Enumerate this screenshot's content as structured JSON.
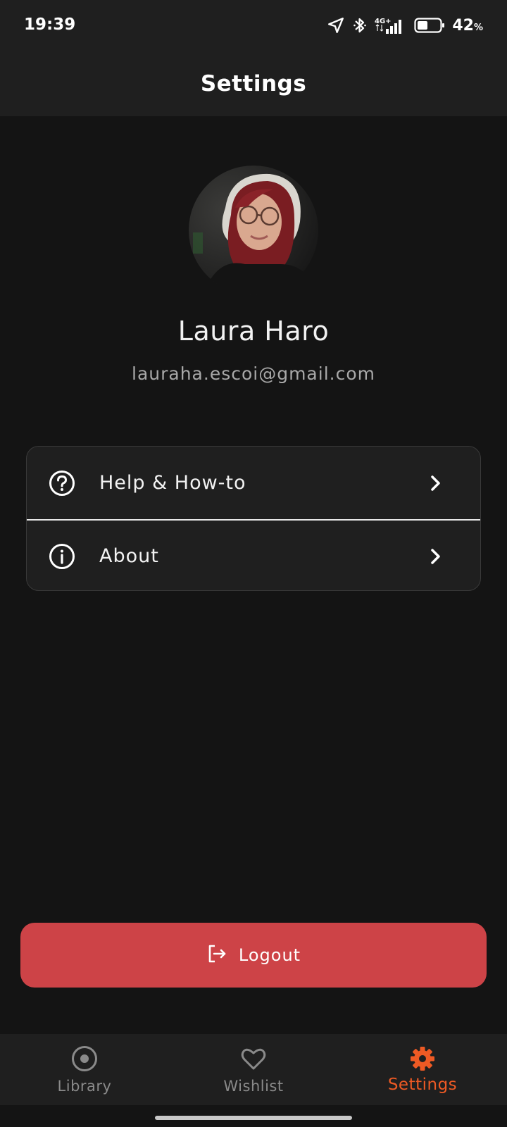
{
  "status_bar": {
    "time": "19:39",
    "network": "4G+",
    "battery_percent": "42",
    "battery_unit": "%",
    "icons": [
      "location-arrow-icon",
      "bluetooth-icon",
      "signal-icon",
      "battery-icon"
    ]
  },
  "app_bar": {
    "title": "Settings"
  },
  "profile": {
    "name": "Laura Haro",
    "email": "lauraha.escoi@gmail.com"
  },
  "menu": {
    "items": [
      {
        "label": "Help & How-to",
        "icon": "help-circle-icon"
      },
      {
        "label": "About",
        "icon": "info-circle-icon"
      }
    ]
  },
  "logout": {
    "label": "Logout",
    "icon": "logout-icon"
  },
  "bottom_nav": {
    "items": [
      {
        "label": "Library",
        "icon": "disc-icon",
        "active": false
      },
      {
        "label": "Wishlist",
        "icon": "heart-icon",
        "active": false
      },
      {
        "label": "Settings",
        "icon": "gear-icon",
        "active": true
      }
    ]
  },
  "colors": {
    "background": "#141414",
    "surface": "#1f1f1f",
    "accent": "#ee5a24",
    "logout": "#cd4347",
    "muted_text": "#a8a8a8"
  }
}
